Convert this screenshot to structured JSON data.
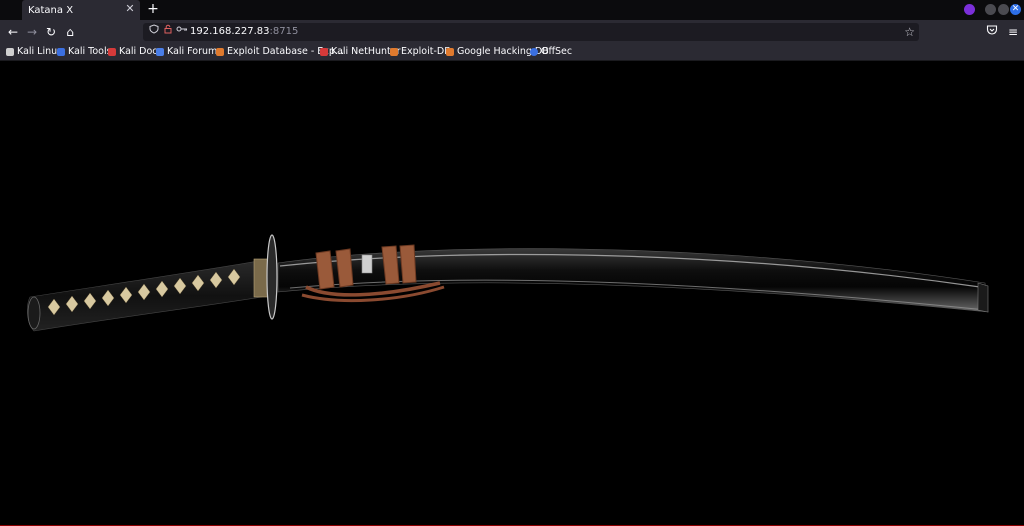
{
  "tab": {
    "title": "Katana X",
    "close": "✕"
  },
  "newtab": "+",
  "nav": {
    "back": "←",
    "forward": "→",
    "reload": "↻",
    "home": "⌂"
  },
  "url": {
    "host": "192.168.227.83",
    "port": ":8715"
  },
  "bookmarks": [
    {
      "label": "Kali Linux",
      "color": "#cfcfcf"
    },
    {
      "label": "Kali Tools",
      "color": "#3b6fe0"
    },
    {
      "label": "Kali Docs",
      "color": "#d63a3a"
    },
    {
      "label": "Kali Forums",
      "color": "#4a7ee8"
    },
    {
      "label": "Exploit Database - Exp...",
      "color": "#e07a2e"
    },
    {
      "label": "Kali NetHunter",
      "color": "#d63a3a"
    },
    {
      "label": "Exploit-DB",
      "color": "#e07a2e"
    },
    {
      "label": "Google Hacking DB",
      "color": "#e07a2e"
    },
    {
      "label": "OffSec",
      "color": "#3b6fe0"
    }
  ],
  "colors": {
    "accent": "#8b0000",
    "background": "#000000"
  },
  "image": {
    "subject": "katana-sword"
  }
}
